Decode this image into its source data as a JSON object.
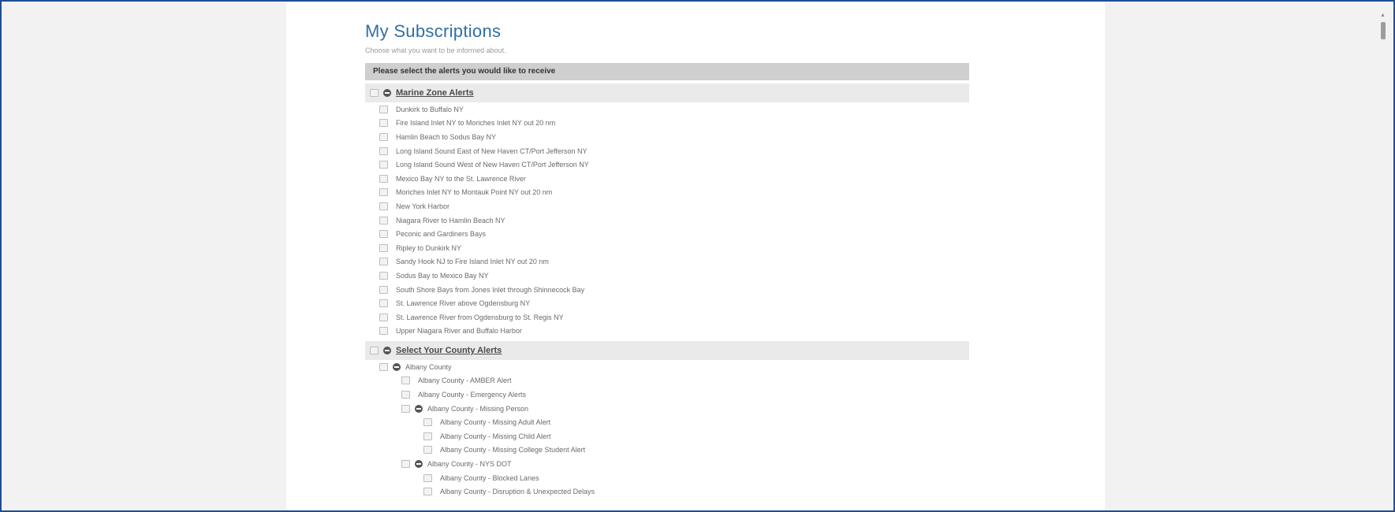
{
  "page": {
    "title": "My Subscriptions",
    "subtitle": "Choose what you want to be informed about.",
    "header": "Please select the alerts you would like to receive"
  },
  "marine": {
    "label": "Marine Zone Alerts",
    "items": [
      "Dunkirk to Buffalo NY",
      "Fire Island Inlet NY to Moriches Inlet NY out 20 nm",
      "Hamlin Beach to Sodus Bay NY",
      "Long Island Sound East of New Haven CT/Port Jefferson NY",
      "Long Island Sound West of New Haven CT/Port Jefferson NY",
      "Mexico Bay NY to the St. Lawrence River",
      "Moriches Inlet NY to Montauk Point NY out 20 nm",
      "New York Harbor",
      "Niagara River to Hamlin Beach NY",
      "Peconic and Gardiners Bays",
      "Ripley to Dunkirk NY",
      "Sandy Hook NJ to Fire Island Inlet NY out 20 nm",
      "Sodus Bay to Mexico Bay NY",
      "South Shore Bays from Jones Inlet through Shinnecock Bay",
      "St. Lawrence River above Ogdensburg NY",
      "St. Lawrence River from Ogdensburg to St. Regis NY",
      "Upper Niagara River and Buffalo Harbor"
    ]
  },
  "county": {
    "label": "Select Your County Alerts",
    "albany": "Albany County",
    "amber": "Albany County - AMBER Alert",
    "emergency": "Albany County - Emergency Alerts",
    "missing_person": "Albany County - Missing Person",
    "missing_items": [
      "Albany County - Missing Adult Alert",
      "Albany County - Missing Child Alert",
      "Albany County - Missing College Student Alert"
    ],
    "nysdot": "Albany County - NYS DOT",
    "nysdot_items": [
      "Albany County - Blocked Lanes",
      "Albany County - Disruption & Unexpected Delays"
    ]
  },
  "colors": {
    "title": "#2f6fa8",
    "frame_border": "#1f4e96",
    "header_bar": "#cfcfcf",
    "section_bar": "#eaeaea"
  },
  "icons": {
    "scroll_up": "▲"
  }
}
